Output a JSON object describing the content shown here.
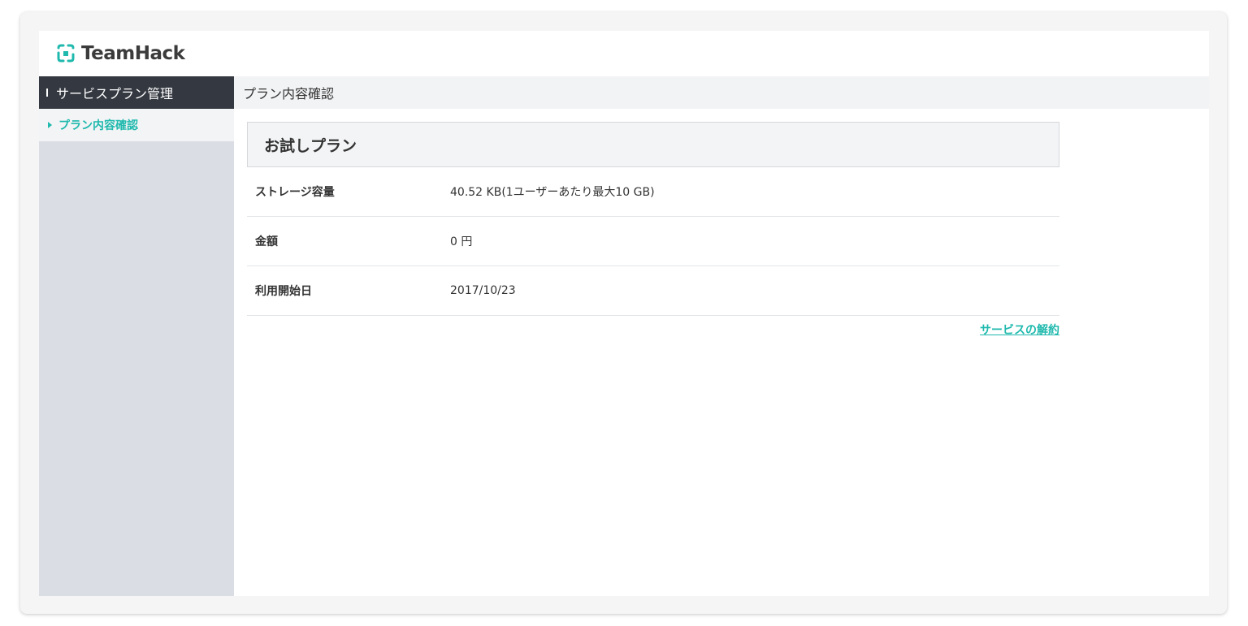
{
  "brand": {
    "name": "TeamHack",
    "accent_color": "#1fb9ad",
    "logo_icon": "teamhack-logo-icon"
  },
  "sidebar": {
    "section_title": "サービスプラン管理",
    "items": [
      {
        "label": "プラン内容確認",
        "active": true
      }
    ]
  },
  "main": {
    "page_title": "プラン内容確認",
    "plan_name": "お試しプラン",
    "details": [
      {
        "label": "ストレージ容量",
        "value": "40.52 KB(1ユーザーあたり最大10 GB)"
      },
      {
        "label": "金額",
        "value": "0 円"
      },
      {
        "label": "利用開始日",
        "value": "2017/10/23"
      }
    ],
    "cancel_link": "サービスの解約"
  }
}
